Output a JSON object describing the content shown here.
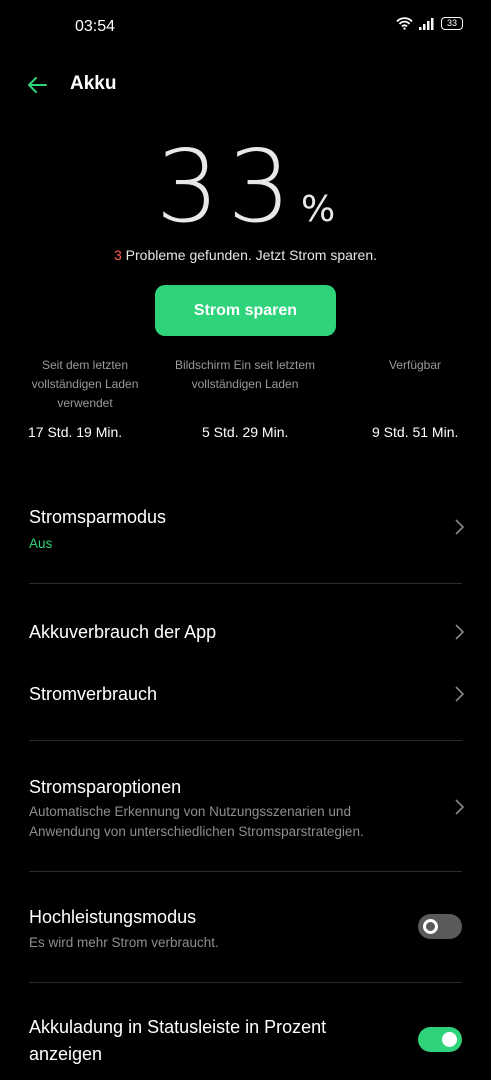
{
  "statusbar": {
    "time": "03:54",
    "battery_level": "33"
  },
  "header": {
    "title": "Akku"
  },
  "battery": {
    "percent": "33",
    "unit": "%"
  },
  "problems": {
    "count": "3",
    "text": " Probleme gefunden. Jetzt Strom sparen."
  },
  "save_button": {
    "label": "Strom sparen"
  },
  "stats": [
    {
      "label_lines": [
        "Seit dem letzten",
        "vollständigen Laden",
        "verwendet"
      ],
      "value": "17 Std. 19 Min."
    },
    {
      "label_lines": [
        "Bildschirm Ein seit letztem",
        "vollständigen Laden"
      ],
      "value": "5 Std. 29 Min."
    },
    {
      "label_lines": [
        "Verfügbar"
      ],
      "value": "9 Std. 51 Min."
    }
  ],
  "settings": {
    "power_saving": {
      "title": "Stromsparmodus",
      "status": "Aus"
    },
    "app_usage": {
      "title": "Akkuverbrauch der App"
    },
    "power_consumption": {
      "title": "Stromverbrauch"
    },
    "power_options": {
      "title": "Stromsparoptionen",
      "description_lines": [
        "Automatische Erkennung von Nutzungsszenarien und",
        "Anwendung von unterschiedlichen Stromsparstrategien."
      ]
    },
    "high_performance": {
      "title": "Hochleistungsmodus",
      "description": "Es wird mehr Strom verbraucht.",
      "enabled": false
    },
    "percent_in_statusbar": {
      "title_lines": [
        "Akkuladung in Statusleiste in Prozent",
        "anzeigen"
      ],
      "enabled": true
    }
  },
  "colors": {
    "accent": "#2ed37a",
    "warning": "#ff5a52",
    "background": "#000000",
    "secondary_text": "#8e8e8e"
  }
}
